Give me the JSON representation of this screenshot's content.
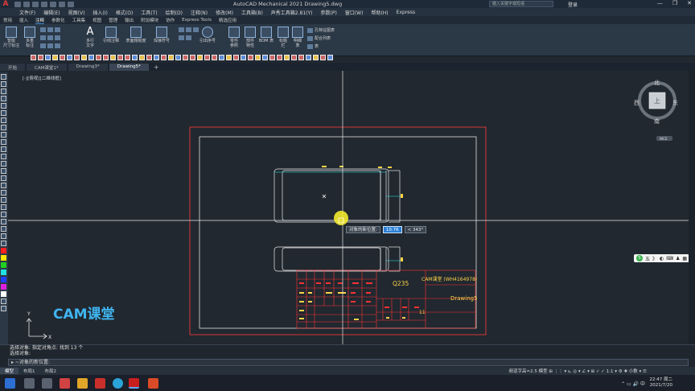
{
  "window": {
    "title": "AutoCAD Mechanical 2021   Drawing5.dwg",
    "search_placeholder": "键入关键字或短语",
    "login": "登录",
    "controls": [
      "—",
      "❐",
      "✕"
    ]
  },
  "menu": [
    "文件(F)",
    "编辑(E)",
    "视图(V)",
    "插入(I)",
    "格式(O)",
    "工具(T)",
    "绘制(D)",
    "注释(N)",
    "修改(M)",
    "工具箱(B)",
    "声秀工具箱2.81(Y)",
    "参数(P)",
    "窗口(W)",
    "帮助(H)",
    "Express"
  ],
  "ribbon_tabs": [
    "常用",
    "插入",
    "注释",
    "参数化",
    "工具集",
    "视图",
    "管理",
    "输出",
    "附加模块",
    "协作",
    "Express Tools",
    "精选应用"
  ],
  "ribbon": {
    "dim_label": "智能\n尺寸标注",
    "multi_label": "多重\n标注",
    "text_label": "多行\n文字",
    "leader_label": "引线注释",
    "surface_label": "表面粗糙度",
    "weld_label": "焊接符号",
    "balloon_label": "引出序号",
    "part_ref_label": "零件\n参照",
    "part_attr_label": "部件\n特性",
    "bom_label": "BOM 表",
    "title_label": "标题\n栏",
    "detail_label": "明细\n表",
    "hole_chart": "孔特征图表",
    "fit_list": "配合列表",
    "table": "表"
  },
  "doc_tabs": [
    "开始",
    "CAM课堂1*",
    "Drawing3*",
    "Drawing5*"
  ],
  "view_label": "[-][俯视][二维线框]",
  "viewcube": {
    "n": "北",
    "s": "南",
    "e": "东",
    "w": "西",
    "top": "上",
    "wcs": "WCS"
  },
  "tooltip": {
    "label": "对象的新位置:",
    "value": "10.76",
    "angle": "< 343°"
  },
  "titleblock": {
    "material": "Q235",
    "company": "CAM课堂 (WH4164978)",
    "drawing": "Drawing5",
    "sheet": "11"
  },
  "watermark": "CAM课堂",
  "ime_bar": [
    "五",
    "》",
    "◐",
    "⌨",
    "♟",
    "▦"
  ],
  "commands": {
    "line1": "选择对象: 指定对角点: 找到 13 个",
    "line2": "选择对象:",
    "input": "▸ ~对象的新位置:"
  },
  "status": {
    "tabs": [
      "模型",
      "布局1",
      "布局2"
    ],
    "right": "频道字高=2.5  模型   ⊞ ⋮⋮ ▾ ⊾ ◎ ▾ ∠ ▾  ⊞ ✓ ✓ 1:1 ▾  ⚙  ✚  小数  ▾  ☰",
    "time": "22:47 周二",
    "date": "2021/7/20"
  },
  "colors": {
    "accent": "#3c8bd6",
    "frame": "#ff3b3b",
    "geometry": "#e8e8e8",
    "annotation": "#ffd447",
    "table": "#ff3333",
    "cyan": "#2ff2e5"
  }
}
